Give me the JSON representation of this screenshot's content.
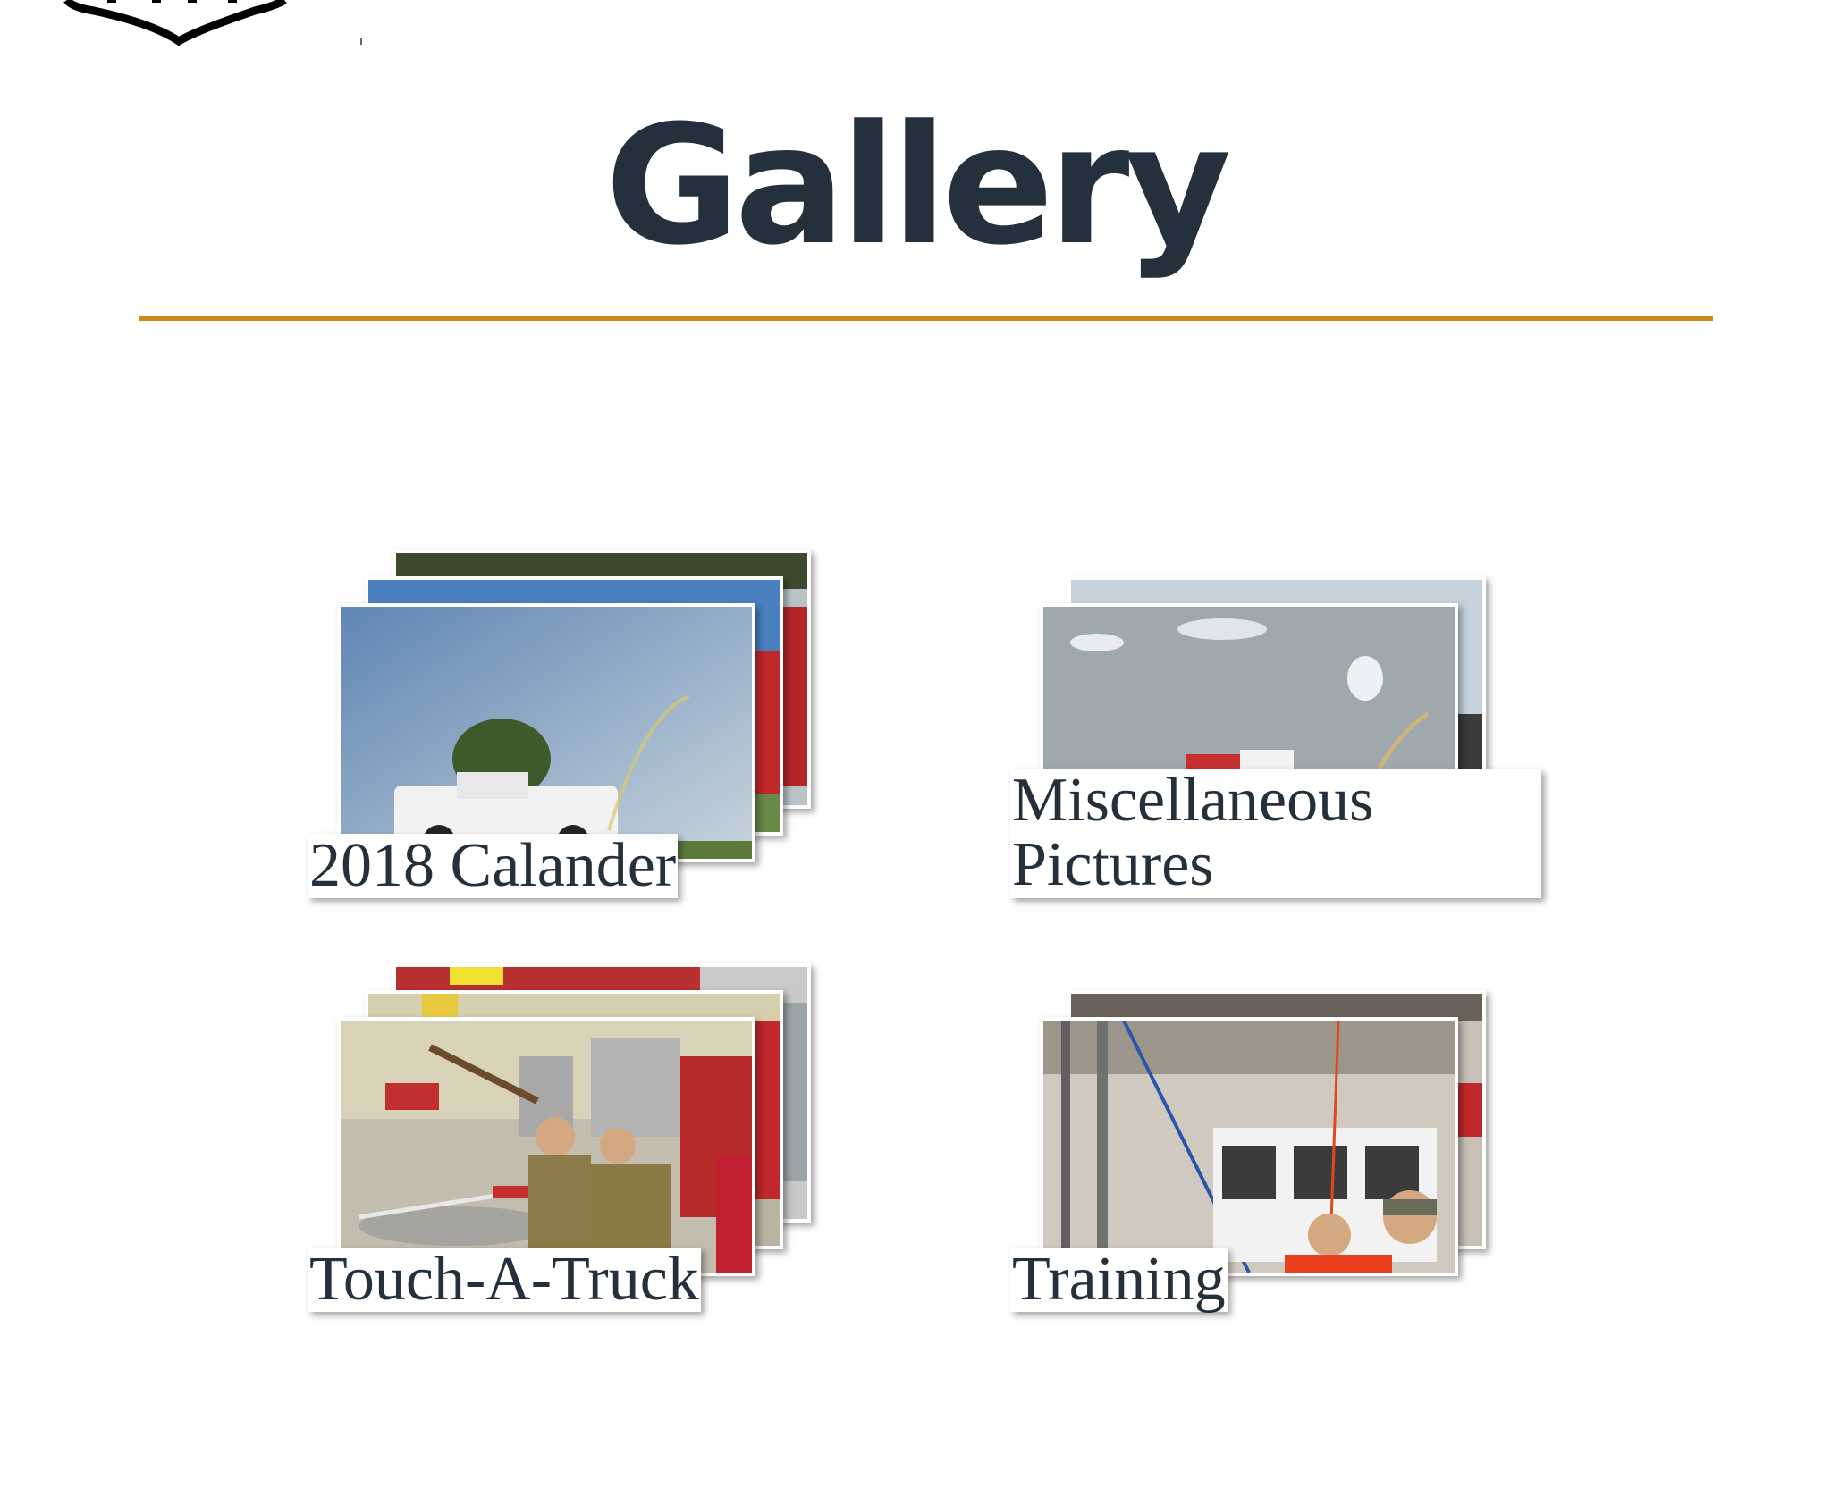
{
  "page": {
    "title": "Gallery"
  },
  "header": {
    "logo_alt": "Fire department logo"
  },
  "colors": {
    "accent_rule": "#c68a1a",
    "text": "#25303d"
  },
  "albums": [
    {
      "name": "2018 Calander"
    },
    {
      "name": "Miscellaneous Pictures"
    },
    {
      "name": "Touch-A-Truck"
    },
    {
      "name": "Training"
    }
  ]
}
